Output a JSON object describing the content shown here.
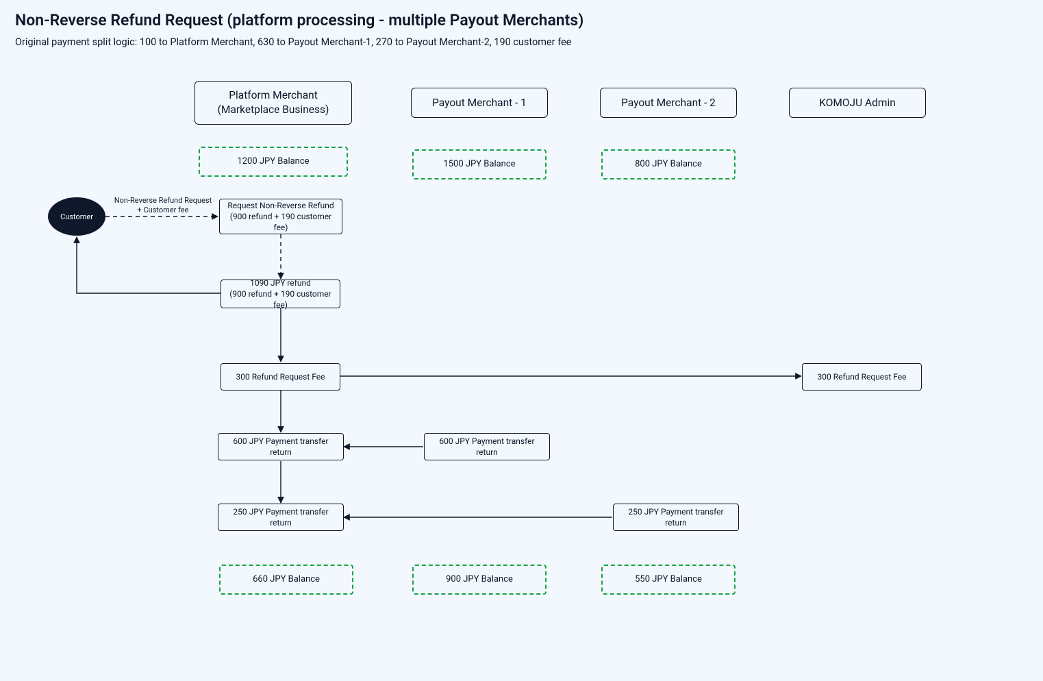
{
  "title": "Non-Reverse Refund Request (platform processing - multiple Payout Merchants)",
  "subtitle": "Original payment split logic: 100 to Platform Merchant, 630 to Payout Merchant-1, 270 to Payout Merchant-2, 190 customer fee",
  "headers": {
    "platform": "Platform Merchant\n(Marketplace Business)",
    "payout1": "Payout Merchant - 1",
    "payout2": "Payout Merchant - 2",
    "admin": "KOMOJU Admin"
  },
  "balances_initial": {
    "platform": "1200 JPY Balance",
    "payout1": "1500 JPY Balance",
    "payout2": "800 JPY Balance"
  },
  "balances_final": {
    "platform": "660 JPY Balance",
    "payout1": "900 JPY Balance",
    "payout2": "550 JPY Balance"
  },
  "nodes": {
    "customer": "Customer",
    "request": "Request Non-Reverse Refund\n(900 refund + 190 customer fee)",
    "refund_total": "1090 JPY refund\n(900 refund + 190 customer fee)",
    "fee_platform": "300 Refund Request Fee",
    "fee_admin": "300 Refund Request Fee",
    "ptr600_platform": "600 JPY Payment transfer return",
    "ptr600_payout1": "600 JPY Payment transfer return",
    "ptr250_platform": "250 JPY Payment transfer return",
    "ptr250_payout2": "250 JPY Payment transfer return"
  },
  "edge_labels": {
    "cust_to_req": "Non-Reverse Refund Request\n+ Customer fee"
  }
}
